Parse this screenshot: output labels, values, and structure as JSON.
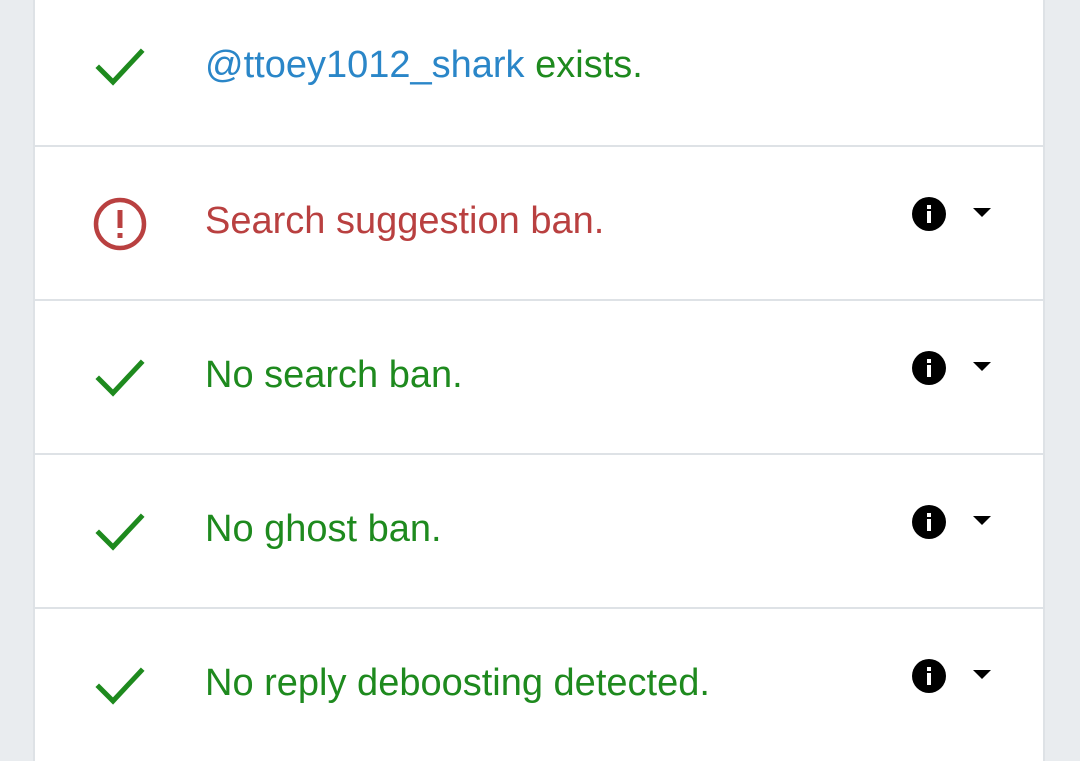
{
  "colors": {
    "success": "#1e8a1e",
    "danger": "#b94040",
    "handle": "#2a86c8"
  },
  "checks": [
    {
      "status": "ok",
      "icon": "check-icon",
      "handle": "@ttoey1012_shark",
      "text": " exists."
    },
    {
      "status": "bad",
      "icon": "alert-circle-icon",
      "text": "Search suggestion ban.",
      "has_info": true
    },
    {
      "status": "ok",
      "icon": "check-icon",
      "text": "No search ban.",
      "has_info": true
    },
    {
      "status": "ok",
      "icon": "check-icon",
      "text": "No ghost ban.",
      "has_info": true
    },
    {
      "status": "ok",
      "icon": "check-icon",
      "text": "No reply deboosting detected.",
      "has_info": true
    }
  ]
}
